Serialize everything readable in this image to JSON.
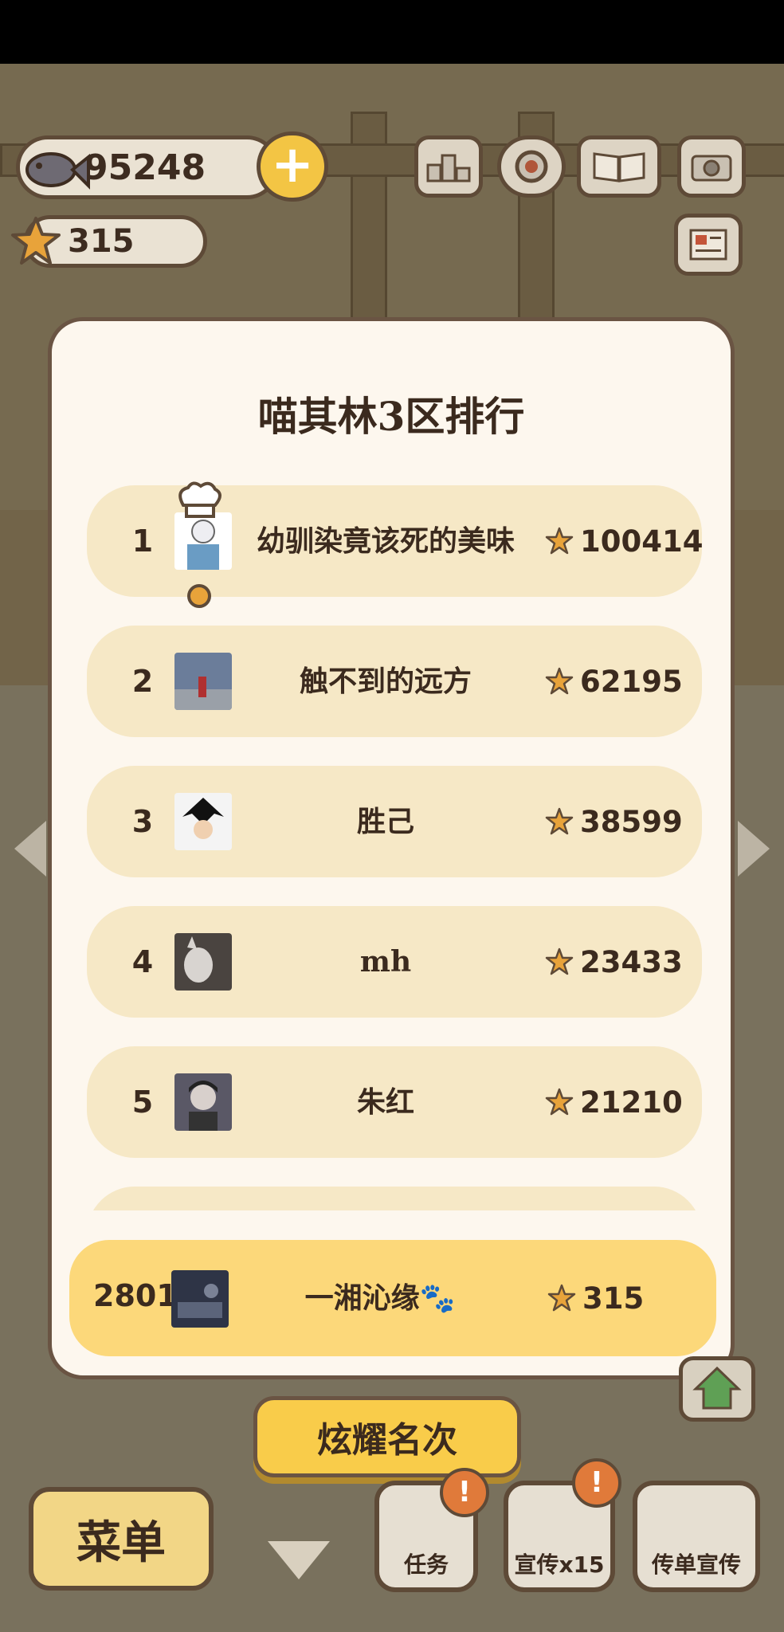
{
  "hud": {
    "coins": "95248",
    "stars": "315"
  },
  "modal": {
    "title": "喵其林3区排行",
    "rows": [
      {
        "rank": "1",
        "name": "幼驯染竟该死的美味",
        "score": "100414"
      },
      {
        "rank": "2",
        "name": "触不到的远方",
        "score": "62195"
      },
      {
        "rank": "3",
        "name": "胜己",
        "score": "38599"
      },
      {
        "rank": "4",
        "name": "mh",
        "score": "23433"
      },
      {
        "rank": "5",
        "name": "朱红",
        "score": "21210"
      }
    ],
    "self": {
      "rank": "2801",
      "name": "一湘沁缘🐾",
      "score": "315"
    }
  },
  "show_button": "炫耀名次",
  "bottom": {
    "menu": "菜单",
    "tasks": "任务",
    "promo": "宣传x15",
    "flyer": "传单宣传",
    "badge_mark": "!"
  },
  "colors": {
    "panel_bg": "#fdf7ee",
    "row_bg": "#f6e8c6",
    "self_row_bg": "#fcd87a",
    "accent_yellow": "#f9cc4a",
    "border_brown": "#6a5443"
  }
}
